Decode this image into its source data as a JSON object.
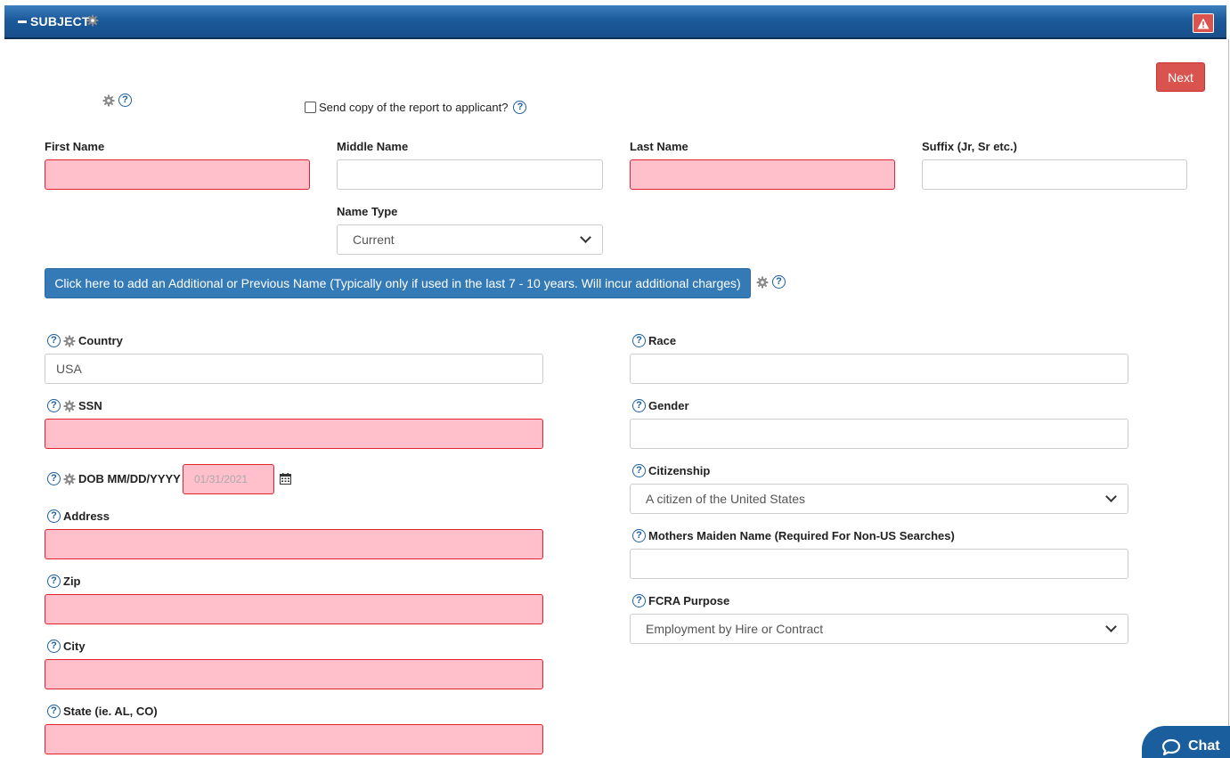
{
  "header": {
    "title": "SUBJECT"
  },
  "actions": {
    "next_label": "Next"
  },
  "send_copy": {
    "label": "Send copy of the report to applicant?"
  },
  "name": {
    "first_label": "First Name",
    "middle_label": "Middle Name",
    "last_label": "Last Name",
    "suffix_label": "Suffix (Jr, Sr etc.)",
    "type_label": "Name Type",
    "type_value": "Current"
  },
  "add_name_button": "Click here to add an Additional or Previous Name (Typically only if used in the last 7 - 10 years. Will incur additional charges)",
  "left": {
    "country_label": "Country",
    "country_value": "USA",
    "ssn_label": "SSN",
    "dob_label": "DOB MM/DD/YYYY",
    "dob_placeholder": "01/31/2021",
    "address_label": "Address",
    "zip_label": "Zip",
    "city_label": "City",
    "state_label": "State (ie. AL, CO)"
  },
  "right": {
    "race_label": "Race",
    "gender_label": "Gender",
    "citizenship_label": "Citizenship",
    "citizenship_value": "A citizen of the United States",
    "maiden_label": "Mothers Maiden Name (Required For Non-US Searches)",
    "fcra_label": "FCRA Purpose",
    "fcra_value": "Employment by Hire or Contract"
  },
  "chat": {
    "label": "Chat"
  },
  "icons": {
    "help": "question-circle-icon",
    "gear": "gear-icon",
    "alert": "warning-icon",
    "calendar": "calendar-icon",
    "chat": "chat-bubble-icon"
  },
  "colors": {
    "header_blue": "#1b5a9a",
    "required_bg": "#ffc0cb",
    "required_border": "#e0222e",
    "next_red": "#d9534f",
    "button_blue": "#337ab7",
    "help_blue": "#1c5ea4"
  }
}
